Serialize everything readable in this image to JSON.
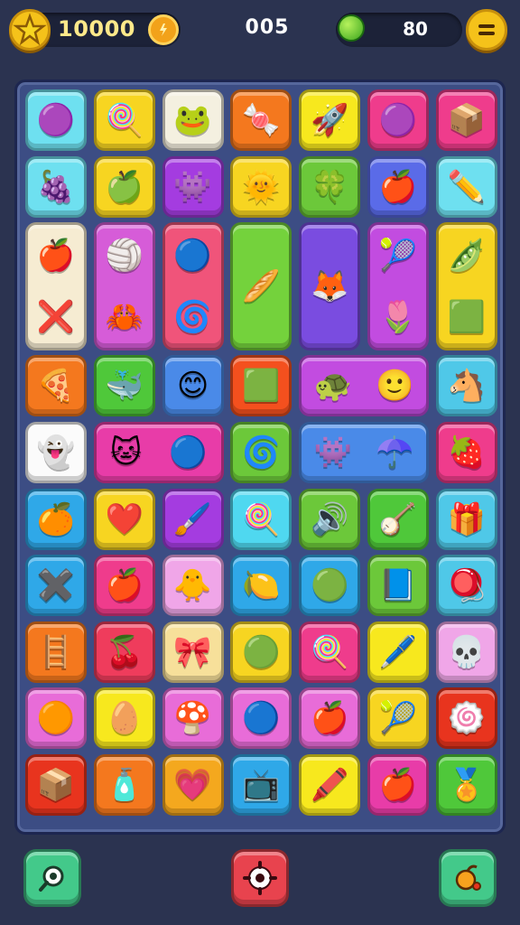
{
  "hud": {
    "coins": "10000",
    "level": "005",
    "gems": "80",
    "icons": {
      "star_badge": "star-icon",
      "coin": "coin-icon",
      "gem": "green-ball-icon",
      "menu": "menu-icon"
    }
  },
  "board": {
    "rows": 11,
    "cols": 7,
    "tiles": [
      {
        "r": 0,
        "c": 0,
        "w": 1,
        "h": 1,
        "color": "#6ee0f0",
        "icons": [
          "🟣"
        ],
        "names": [
          "purple-ball-icon"
        ]
      },
      {
        "r": 0,
        "c": 1,
        "w": 1,
        "h": 1,
        "color": "#f7d521",
        "icons": [
          "🍭"
        ],
        "names": [
          "lollipop-icon"
        ]
      },
      {
        "r": 0,
        "c": 2,
        "w": 1,
        "h": 1,
        "color": "#f4f0e0",
        "icons": [
          "🐸"
        ],
        "names": [
          "green-blob-icon"
        ]
      },
      {
        "r": 0,
        "c": 3,
        "w": 1,
        "h": 1,
        "color": "#f4781e",
        "icons": [
          "🍬"
        ],
        "names": [
          "candy-icon"
        ]
      },
      {
        "r": 0,
        "c": 4,
        "w": 1,
        "h": 1,
        "color": "#f7e81e",
        "icons": [
          "🚀"
        ],
        "names": [
          "rocket-icon"
        ]
      },
      {
        "r": 0,
        "c": 5,
        "w": 1,
        "h": 1,
        "color": "#ef3c8c",
        "icons": [
          "🟣"
        ],
        "names": [
          "purple-ball-icon"
        ]
      },
      {
        "r": 0,
        "c": 6,
        "w": 1,
        "h": 1,
        "color": "#ef3c8c",
        "icons": [
          "📦"
        ],
        "names": [
          "box-icon"
        ]
      },
      {
        "r": 1,
        "c": 0,
        "w": 1,
        "h": 1,
        "color": "#6ee0f0",
        "icons": [
          "🍇"
        ],
        "names": [
          "plum-icon"
        ]
      },
      {
        "r": 1,
        "c": 1,
        "w": 1,
        "h": 1,
        "color": "#f7d521",
        "icons": [
          "🍏"
        ],
        "names": [
          "green-apple-icon"
        ]
      },
      {
        "r": 1,
        "c": 2,
        "w": 1,
        "h": 1,
        "color": "#a43ce0",
        "icons": [
          "👾"
        ],
        "names": [
          "purple-monster-icon"
        ]
      },
      {
        "r": 1,
        "c": 3,
        "w": 1,
        "h": 1,
        "color": "#f7d521",
        "icons": [
          "🌞"
        ],
        "names": [
          "sun-icon"
        ]
      },
      {
        "r": 1,
        "c": 4,
        "w": 1,
        "h": 1,
        "color": "#6cc83a",
        "icons": [
          "🍀"
        ],
        "names": [
          "green-blob-icon"
        ]
      },
      {
        "r": 1,
        "c": 5,
        "w": 1,
        "h": 1,
        "color": "#5a6be8",
        "icons": [
          "🍎"
        ],
        "names": [
          "red-apple-icon"
        ]
      },
      {
        "r": 1,
        "c": 6,
        "w": 1,
        "h": 1,
        "color": "#6ee0f0",
        "icons": [
          "✏️"
        ],
        "names": [
          "pencil-icon"
        ]
      },
      {
        "r": 2,
        "c": 0,
        "w": 1,
        "h": 2,
        "color": "#f6ecd2",
        "icons": [
          "🍎",
          "❌"
        ],
        "names": [
          "red-apple-icon",
          "cross-sticks-icon"
        ],
        "vert": true
      },
      {
        "r": 2,
        "c": 1,
        "w": 1,
        "h": 2,
        "color": "#d65cd8",
        "icons": [
          "🏐",
          "🦀"
        ],
        "names": [
          "beach-ball-icon",
          "red-creature-icon"
        ],
        "vert": true
      },
      {
        "r": 2,
        "c": 2,
        "w": 1,
        "h": 2,
        "color": "#f0547a",
        "icons": [
          "🔵",
          "🌀"
        ],
        "names": [
          "striped-ball-icon",
          "swirl-icon"
        ],
        "vert": true
      },
      {
        "r": 2,
        "c": 3,
        "w": 1,
        "h": 2,
        "color": "#74d23c",
        "icons": [
          "🥖"
        ],
        "names": [
          "stick-icon"
        ],
        "vert": true
      },
      {
        "r": 2,
        "c": 4,
        "w": 1,
        "h": 2,
        "color": "#7a4ce0",
        "icons": [
          "🦊"
        ],
        "names": [
          "fox-icon"
        ],
        "vert": true
      },
      {
        "r": 2,
        "c": 5,
        "w": 1,
        "h": 2,
        "color": "#c24ce0",
        "icons": [
          "🎾",
          "🌷"
        ],
        "names": [
          "striped-ball-icon",
          "flower-icon"
        ],
        "vert": true
      },
      {
        "r": 2,
        "c": 6,
        "w": 1,
        "h": 2,
        "color": "#f7d521",
        "icons": [
          "🫛",
          "🟩"
        ],
        "names": [
          "green-blob-icon",
          "green-cube-icon"
        ],
        "vert": true
      },
      {
        "r": 4,
        "c": 0,
        "w": 1,
        "h": 1,
        "color": "#f4781e",
        "icons": [
          "🍕"
        ],
        "names": [
          "taco-icon"
        ]
      },
      {
        "r": 4,
        "c": 1,
        "w": 1,
        "h": 1,
        "color": "#4fc83a",
        "icons": [
          "🐳"
        ],
        "names": [
          "blue-blob-icon"
        ]
      },
      {
        "r": 4,
        "c": 2,
        "w": 1,
        "h": 1,
        "color": "#4a8ae8",
        "icons": [
          "😊"
        ],
        "names": [
          "smiley-icon"
        ]
      },
      {
        "r": 4,
        "c": 3,
        "w": 1,
        "h": 1,
        "color": "#f4501e",
        "icons": [
          "🟩"
        ],
        "names": [
          "green-cube-icon"
        ]
      },
      {
        "r": 4,
        "c": 4,
        "w": 2,
        "h": 1,
        "color": "#c24ce0",
        "icons": [
          "🐢",
          "🙂"
        ],
        "names": [
          "green-turtle-icon",
          "smiley-icon"
        ]
      },
      {
        "r": 4,
        "c": 6,
        "w": 1,
        "h": 1,
        "color": "#4fc8e8",
        "icons": [
          "🐴"
        ],
        "names": [
          "horse-icon"
        ]
      },
      {
        "r": 5,
        "c": 0,
        "w": 1,
        "h": 1,
        "color": "#fbfbfb",
        "icons": [
          "👻"
        ],
        "names": [
          "purple-ghost-icon"
        ]
      },
      {
        "r": 5,
        "c": 1,
        "w": 2,
        "h": 1,
        "color": "#e83ca8",
        "icons": [
          "🐱",
          "🔵"
        ],
        "names": [
          "yellow-cat-icon",
          "striped-ball-icon"
        ]
      },
      {
        "r": 5,
        "c": 3,
        "w": 1,
        "h": 1,
        "color": "#6cc83a",
        "icons": [
          "🌀"
        ],
        "names": [
          "spiral-icon"
        ]
      },
      {
        "r": 5,
        "c": 4,
        "w": 2,
        "h": 1,
        "color": "#4a8ae8",
        "icons": [
          "👾",
          "☂️"
        ],
        "names": [
          "purple-monster-icon",
          "umbrella-icon"
        ]
      },
      {
        "r": 5,
        "c": 6,
        "w": 1,
        "h": 1,
        "color": "#ef3c8c",
        "icons": [
          "🍓"
        ],
        "names": [
          "strawberry-icon"
        ]
      },
      {
        "r": 6,
        "c": 0,
        "w": 1,
        "h": 1,
        "color": "#2fa8e8",
        "icons": [
          "🍊"
        ],
        "names": [
          "orange-face-icon"
        ]
      },
      {
        "r": 6,
        "c": 1,
        "w": 1,
        "h": 1,
        "color": "#f7d521",
        "icons": [
          "❤️"
        ],
        "names": [
          "heart-icon"
        ]
      },
      {
        "r": 6,
        "c": 2,
        "w": 1,
        "h": 1,
        "color": "#a43ce0",
        "icons": [
          "🖌️"
        ],
        "names": [
          "brush-icon"
        ]
      },
      {
        "r": 6,
        "c": 3,
        "w": 1,
        "h": 1,
        "color": "#4fd8f0",
        "icons": [
          "🍭"
        ],
        "names": [
          "lollipop-icon"
        ]
      },
      {
        "r": 6,
        "c": 4,
        "w": 1,
        "h": 1,
        "color": "#6cc83a",
        "icons": [
          "🔊"
        ],
        "names": [
          "speaker-icon"
        ]
      },
      {
        "r": 6,
        "c": 5,
        "w": 1,
        "h": 1,
        "color": "#4fc83a",
        "icons": [
          "🪕"
        ],
        "names": [
          "guitar-icon"
        ]
      },
      {
        "r": 6,
        "c": 6,
        "w": 1,
        "h": 1,
        "color": "#4fc8e8",
        "icons": [
          "🎁"
        ],
        "names": [
          "gift-box-icon"
        ]
      },
      {
        "r": 7,
        "c": 0,
        "w": 1,
        "h": 1,
        "color": "#2fa8e8",
        "icons": [
          "✖️"
        ],
        "names": [
          "cross-icon"
        ]
      },
      {
        "r": 7,
        "c": 1,
        "w": 1,
        "h": 1,
        "color": "#ef3c8c",
        "icons": [
          "🍎"
        ],
        "names": [
          "red-apple-icon"
        ]
      },
      {
        "r": 7,
        "c": 2,
        "w": 1,
        "h": 1,
        "color": "#f0a6e8",
        "icons": [
          "🐥"
        ],
        "names": [
          "chick-icon"
        ]
      },
      {
        "r": 7,
        "c": 3,
        "w": 1,
        "h": 1,
        "color": "#2fa8e8",
        "icons": [
          "🍋"
        ],
        "names": [
          "yellow-fruit-icon"
        ]
      },
      {
        "r": 7,
        "c": 4,
        "w": 1,
        "h": 1,
        "color": "#2fa8e8",
        "icons": [
          "🟢"
        ],
        "names": [
          "green-balloon-icon"
        ]
      },
      {
        "r": 7,
        "c": 5,
        "w": 1,
        "h": 1,
        "color": "#6cc83a",
        "icons": [
          "📘"
        ],
        "names": [
          "blue-book-icon"
        ]
      },
      {
        "r": 7,
        "c": 6,
        "w": 1,
        "h": 1,
        "color": "#4fc8e8",
        "icons": [
          "🪀"
        ],
        "names": [
          "yoyo-icon"
        ]
      },
      {
        "r": 8,
        "c": 0,
        "w": 1,
        "h": 1,
        "color": "#f4781e",
        "icons": [
          "🪜"
        ],
        "names": [
          "ladder-icon"
        ]
      },
      {
        "r": 8,
        "c": 1,
        "w": 1,
        "h": 1,
        "color": "#ef3c5c",
        "icons": [
          "🍒"
        ],
        "names": [
          "cherry-icon"
        ]
      },
      {
        "r": 8,
        "c": 2,
        "w": 1,
        "h": 1,
        "color": "#f7e09a",
        "icons": [
          "🎀"
        ],
        "names": [
          "ribbon-icon"
        ]
      },
      {
        "r": 8,
        "c": 3,
        "w": 1,
        "h": 1,
        "color": "#f7d521",
        "icons": [
          "🟢"
        ],
        "names": [
          "green-magnifier-icon"
        ]
      },
      {
        "r": 8,
        "c": 4,
        "w": 1,
        "h": 1,
        "color": "#ef3c8c",
        "icons": [
          "🍭"
        ],
        "names": [
          "lollipop-icon"
        ]
      },
      {
        "r": 8,
        "c": 5,
        "w": 1,
        "h": 1,
        "color": "#f7e81e",
        "icons": [
          "🖊️"
        ],
        "names": [
          "pen-icon"
        ]
      },
      {
        "r": 8,
        "c": 6,
        "w": 1,
        "h": 1,
        "color": "#f0a6e8",
        "icons": [
          "💀"
        ],
        "names": [
          "skull-icon"
        ]
      },
      {
        "r": 9,
        "c": 0,
        "w": 1,
        "h": 1,
        "color": "#e86cd8",
        "icons": [
          "🟠"
        ],
        "names": [
          "orange-face-icon"
        ]
      },
      {
        "r": 9,
        "c": 1,
        "w": 1,
        "h": 1,
        "color": "#f7e81e",
        "icons": [
          "🥚"
        ],
        "names": [
          "egg-icon"
        ]
      },
      {
        "r": 9,
        "c": 2,
        "w": 1,
        "h": 1,
        "color": "#e86cd8",
        "icons": [
          "🍄"
        ],
        "names": [
          "mushroom-icon"
        ]
      },
      {
        "r": 9,
        "c": 3,
        "w": 1,
        "h": 1,
        "color": "#e86cd8",
        "icons": [
          "🔵"
        ],
        "names": [
          "blue-ball-icon"
        ]
      },
      {
        "r": 9,
        "c": 4,
        "w": 1,
        "h": 1,
        "color": "#e86cd8",
        "icons": [
          "🍎"
        ],
        "names": [
          "red-apple-icon"
        ]
      },
      {
        "r": 9,
        "c": 5,
        "w": 1,
        "h": 1,
        "color": "#f7d521",
        "icons": [
          "🎾"
        ],
        "names": [
          "striped-ball-icon"
        ]
      },
      {
        "r": 9,
        "c": 6,
        "w": 1,
        "h": 1,
        "color": "#e8341e",
        "icons": [
          "🍥"
        ],
        "names": [
          "spiral-candy-icon"
        ]
      },
      {
        "r": 10,
        "c": 0,
        "w": 1,
        "h": 1,
        "color": "#e8341e",
        "icons": [
          "📦"
        ],
        "names": [
          "box-icon"
        ]
      },
      {
        "r": 10,
        "c": 1,
        "w": 1,
        "h": 1,
        "color": "#f4781e",
        "icons": [
          "🧴"
        ],
        "names": [
          "bottle-icon"
        ]
      },
      {
        "r": 10,
        "c": 2,
        "w": 1,
        "h": 1,
        "color": "#f4a81e",
        "icons": [
          "💗"
        ],
        "names": [
          "heart-icon"
        ]
      },
      {
        "r": 10,
        "c": 3,
        "w": 1,
        "h": 1,
        "color": "#2fa8e8",
        "icons": [
          "📺"
        ],
        "names": [
          "tv-icon"
        ]
      },
      {
        "r": 10,
        "c": 4,
        "w": 1,
        "h": 1,
        "color": "#f7e81e",
        "icons": [
          "🖍️"
        ],
        "names": [
          "crayon-icon"
        ]
      },
      {
        "r": 10,
        "c": 5,
        "w": 1,
        "h": 1,
        "color": "#e83ca8",
        "icons": [
          "🍎"
        ],
        "names": [
          "red-apple-icon"
        ]
      },
      {
        "r": 10,
        "c": 6,
        "w": 1,
        "h": 1,
        "color": "#4fc83a",
        "icons": [
          "🏅"
        ],
        "names": [
          "medal-icon"
        ]
      }
    ]
  },
  "controls": {
    "hint_icon": "magnifier-icon",
    "settings_icon": "gear-icon",
    "boost_icon": "bomb-icon"
  }
}
